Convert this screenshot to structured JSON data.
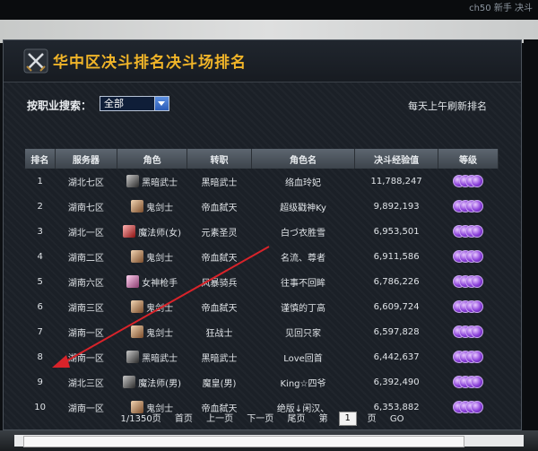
{
  "window": {
    "corner_text": "ch50 新手 决斗"
  },
  "header": {
    "title": "华中区决斗排名决斗场排名",
    "title_color": "#f0b429"
  },
  "filter": {
    "label": "按职业搜索：",
    "selected": "全部",
    "refresh_note": "每天上午刷新排名"
  },
  "table": {
    "headers": [
      "排名",
      "服务器",
      "角色",
      "转职",
      "角色名",
      "决斗经验值",
      "等级"
    ],
    "rows": [
      {
        "rank": "1",
        "server": "湖北七区",
        "role": "黑暗武士",
        "job": "黑暗武士",
        "name": "络血玲妃",
        "exp": "11,788,247",
        "avatar": "dark"
      },
      {
        "rank": "2",
        "server": "湖南七区",
        "role": "鬼剑士",
        "job": "帝血弑天",
        "name": "超级戳神Ky",
        "exp": "9,892,193",
        "avatar": "skin"
      },
      {
        "rank": "3",
        "server": "湖北一区",
        "role": "魔法师(女)",
        "job": "元素圣灵",
        "name": "白づ衣胜雪",
        "exp": "6,953,501",
        "avatar": "red"
      },
      {
        "rank": "4",
        "server": "湖南二区",
        "role": "鬼剑士",
        "job": "帝血弑天",
        "name": "名流、尊者",
        "exp": "6,911,586",
        "avatar": "skin"
      },
      {
        "rank": "5",
        "server": "湖南六区",
        "role": "女神枪手",
        "job": "风暴骑兵",
        "name": "往事不回眸",
        "exp": "6,786,226",
        "avatar": "pink"
      },
      {
        "rank": "6",
        "server": "湖南三区",
        "role": "鬼剑士",
        "job": "帝血弑天",
        "name": "谨慎的丁高",
        "exp": "6,609,724",
        "avatar": "skin"
      },
      {
        "rank": "7",
        "server": "湖南一区",
        "role": "鬼剑士",
        "job": "狂战士",
        "name": "见回只家",
        "exp": "6,597,828",
        "avatar": "skin"
      },
      {
        "rank": "8",
        "server": "湖南一区",
        "role": "黑暗武士",
        "job": "黑暗武士",
        "name": "Love回首",
        "exp": "6,442,637",
        "avatar": "dark"
      },
      {
        "rank": "9",
        "server": "湖北三区",
        "role": "魔法师(男)",
        "job": "魔皇(男)",
        "name": "King☆四爷",
        "exp": "6,392,490",
        "avatar": "dark"
      },
      {
        "rank": "10",
        "server": "湖南一区",
        "role": "鬼剑士",
        "job": "帝血弑天",
        "name": "绝版↓闲汉、",
        "exp": "6,353,882",
        "avatar": "skin"
      }
    ]
  },
  "pager": {
    "total": "1/1350页",
    "first": "首页",
    "prev": "上一页",
    "next": "下一页",
    "last": "尾页",
    "page_prefix": "第",
    "page_value": "1",
    "page_suffix": "页",
    "go": "GO"
  },
  "annotation": {
    "arrow_color": "#d8232a"
  }
}
